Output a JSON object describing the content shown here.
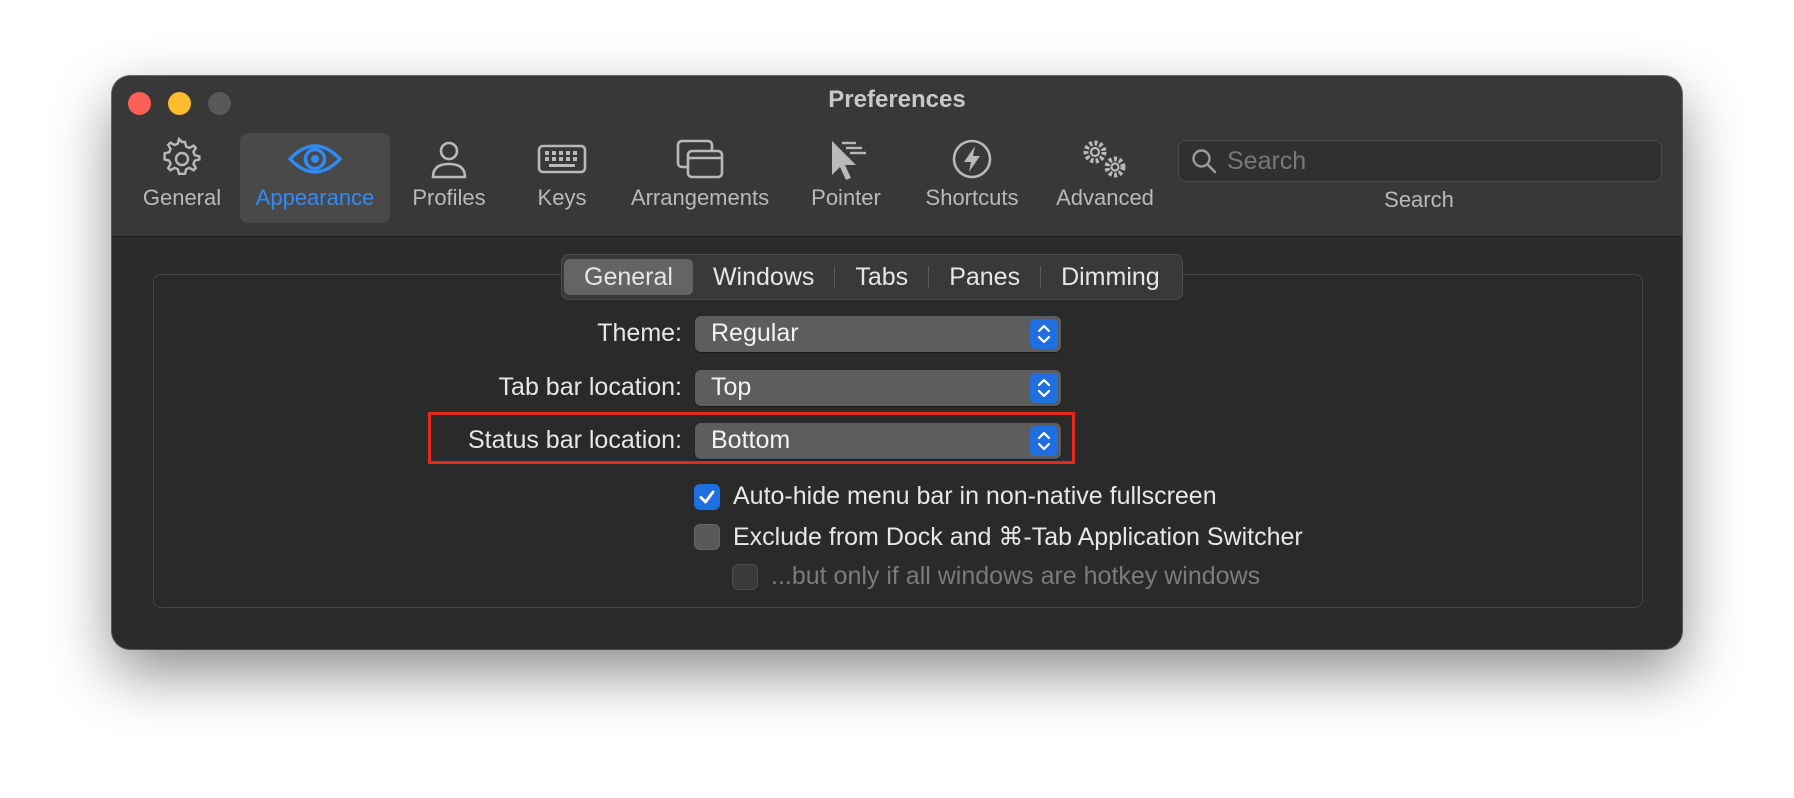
{
  "window": {
    "title": "Preferences"
  },
  "toolbar": {
    "items": [
      {
        "label": "General",
        "icon": "gear-icon",
        "active": false
      },
      {
        "label": "Appearance",
        "icon": "eye-icon",
        "active": true
      },
      {
        "label": "Profiles",
        "icon": "person-icon",
        "active": false
      },
      {
        "label": "Keys",
        "icon": "keyboard-icon",
        "active": false
      },
      {
        "label": "Arrangements",
        "icon": "windows-icon",
        "active": false
      },
      {
        "label": "Pointer",
        "icon": "pointer-icon",
        "active": false
      },
      {
        "label": "Shortcuts",
        "icon": "bolt-icon",
        "active": false
      },
      {
        "label": "Advanced",
        "icon": "gears-icon",
        "active": false
      }
    ],
    "search": {
      "placeholder": "Search",
      "label": "Search"
    }
  },
  "tabs": {
    "items": [
      "General",
      "Windows",
      "Tabs",
      "Panes",
      "Dimming"
    ],
    "selected": "General"
  },
  "settings": {
    "theme": {
      "label": "Theme:",
      "value": "Regular"
    },
    "tab_bar_location": {
      "label": "Tab bar location:",
      "value": "Top"
    },
    "status_bar_location": {
      "label": "Status bar location:",
      "value": "Bottom"
    },
    "auto_hide": {
      "label": "Auto-hide menu bar in non-native fullscreen",
      "checked": true
    },
    "exclude_dock": {
      "label": "Exclude from Dock and ⌘-Tab Application Switcher",
      "checked": false
    },
    "hotkey_only": {
      "label": "...but only if all windows are hotkey windows",
      "checked": false,
      "enabled": false
    }
  },
  "colors": {
    "accent": "#2f8bf6",
    "highlight_box": "#e5271d"
  }
}
